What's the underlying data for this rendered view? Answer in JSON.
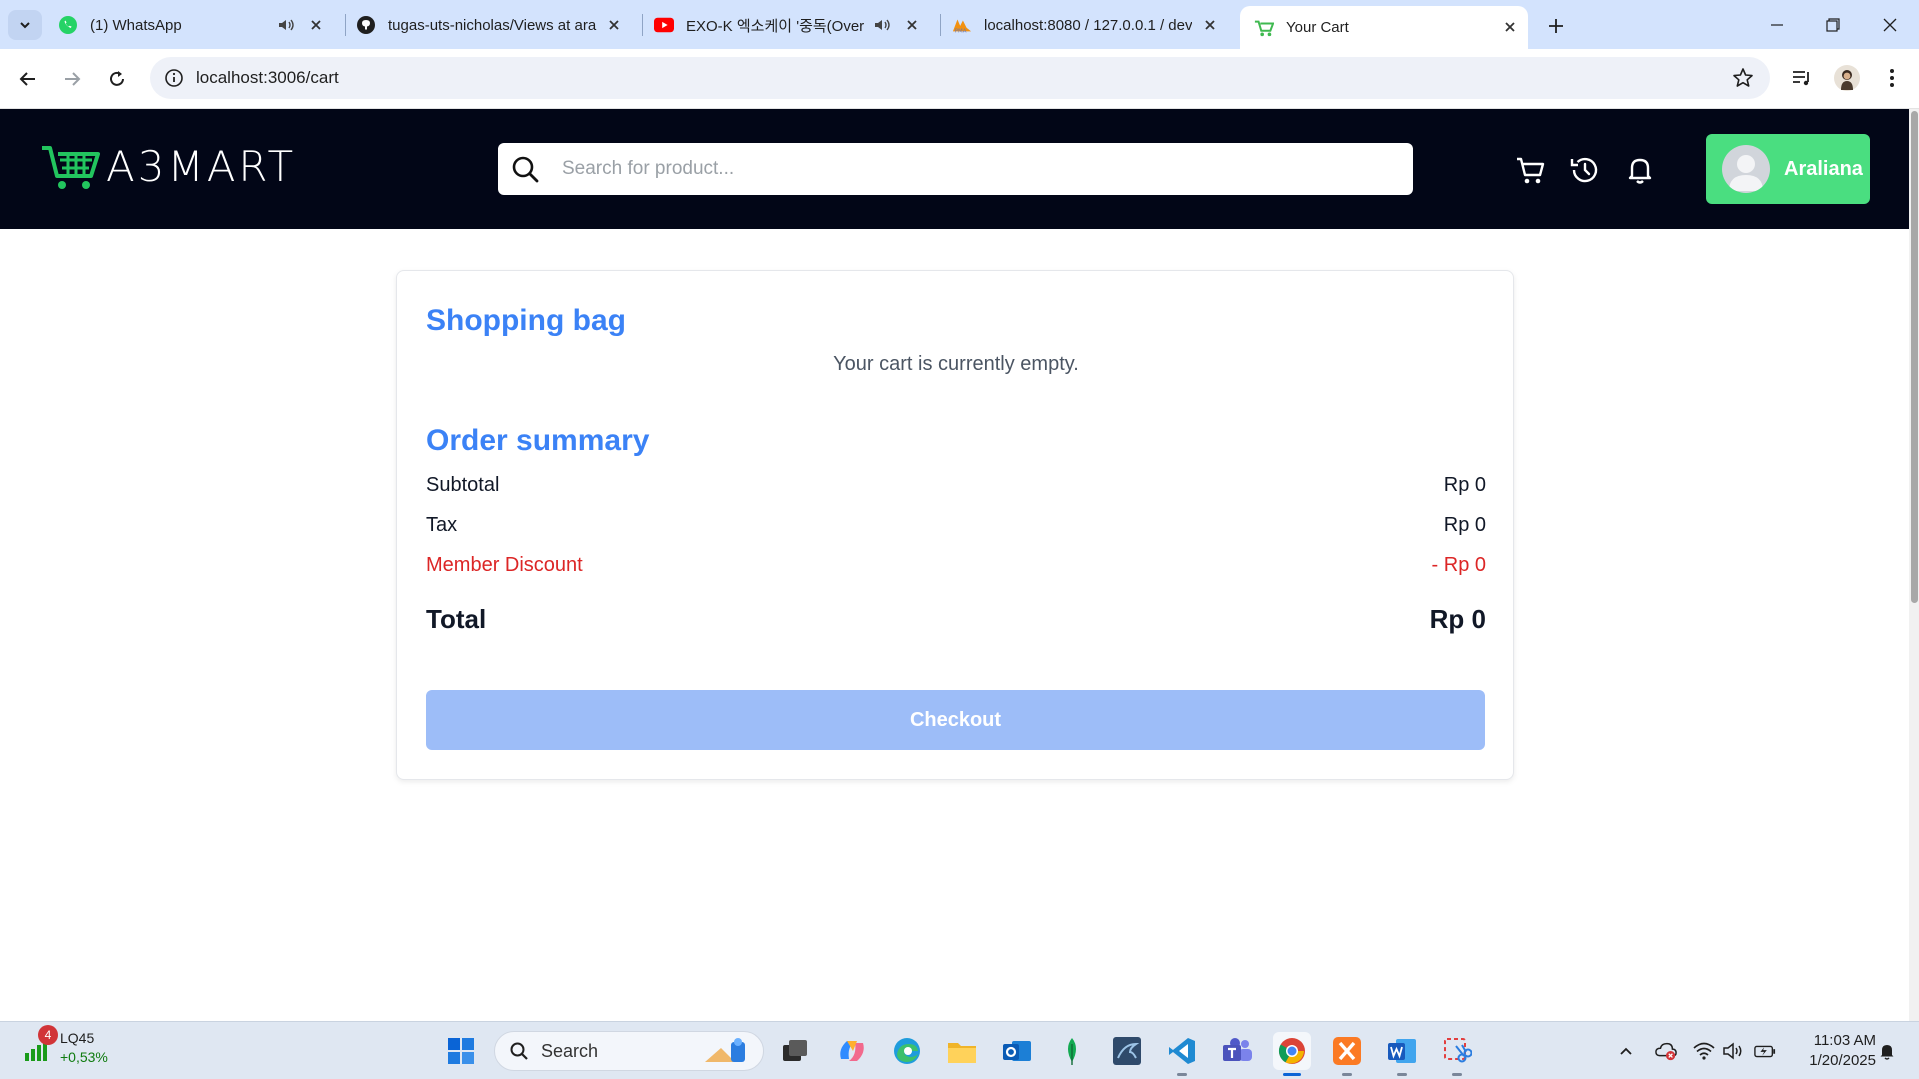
{
  "browser": {
    "tabs": [
      {
        "title": "(1) WhatsApp",
        "icon": "whatsapp-icon",
        "audio": true
      },
      {
        "title": "tugas-uts-nicholas/Views at ara",
        "icon": "github-icon",
        "audio": false
      },
      {
        "title": "EXO-K 엑소케이 '중독(Over",
        "icon": "youtube-icon",
        "audio": true
      },
      {
        "title": "localhost:8080 / 127.0.0.1 / dev",
        "icon": "phpmyadmin-icon",
        "audio": false
      },
      {
        "title": "Your Cart",
        "icon": "a3mart-cart-icon",
        "audio": false,
        "active": true
      }
    ],
    "url": "localhost:3006/cart"
  },
  "site": {
    "brand": "A3MART",
    "search_placeholder": "Search for product...",
    "user_name": "Araliana",
    "colors": {
      "header_bg": "#020617",
      "brand_green": "#4ade80",
      "accent_blue": "#3b82f6",
      "discount_red": "#dc2626",
      "checkout_disabled": "#9dbdf8"
    }
  },
  "cart": {
    "heading": "Shopping bag",
    "empty_message": "Your cart is currently empty.",
    "summary_heading": "Order summary",
    "subtotal_label": "Subtotal",
    "subtotal_value": "Rp 0",
    "tax_label": "Tax",
    "tax_value": "Rp 0",
    "discount_label": "Member Discount",
    "discount_value": "- Rp 0",
    "total_label": "Total",
    "total_value": "Rp 0",
    "checkout_label": "Checkout"
  },
  "taskbar": {
    "stock_name": "LQ45",
    "stock_change": "+0,53%",
    "notification_count": "4",
    "search_label": "Search",
    "time": "11:03 AM",
    "date": "1/20/2025"
  }
}
